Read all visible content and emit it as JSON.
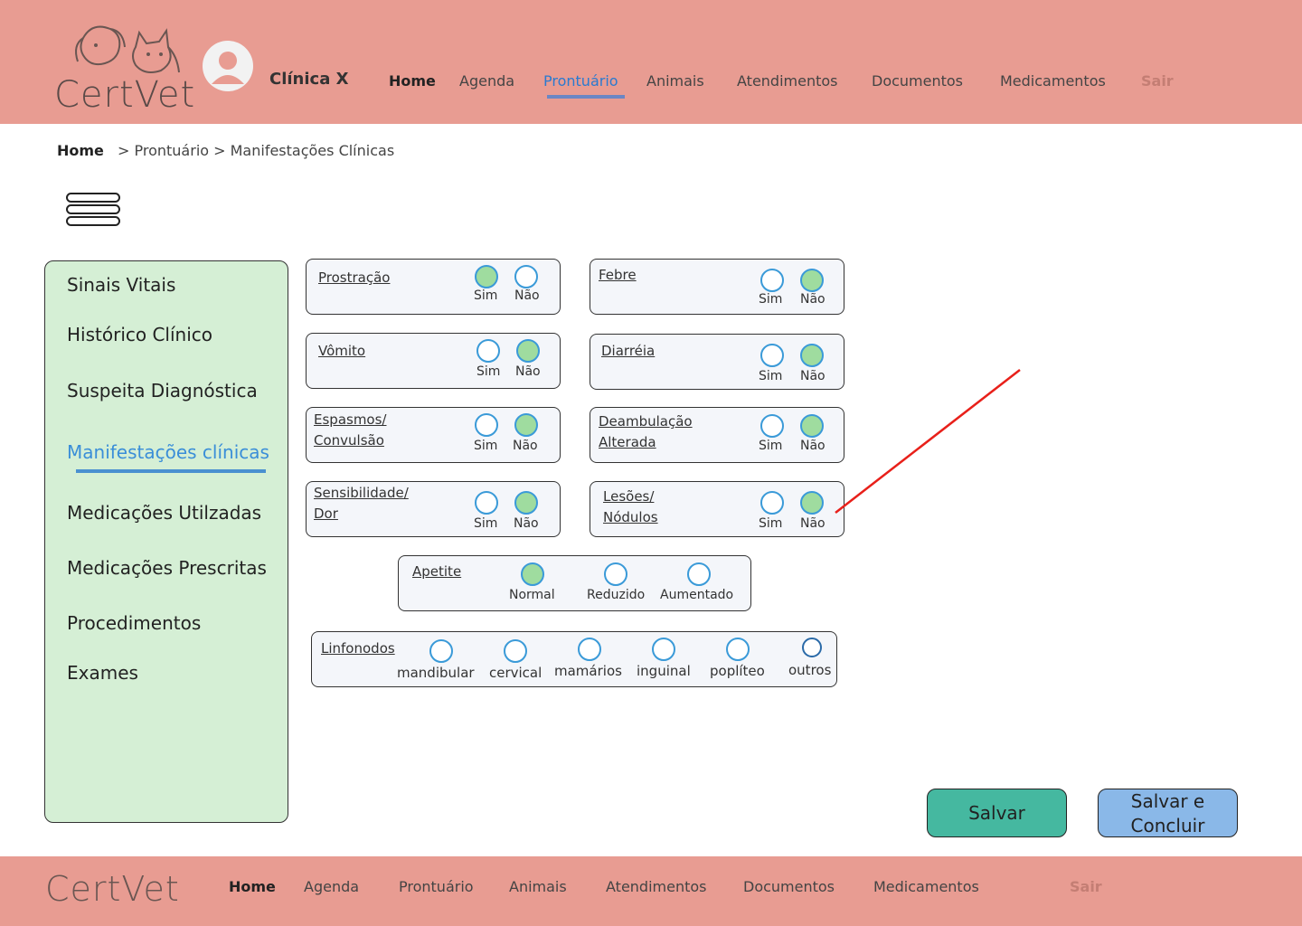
{
  "brand": {
    "name": "CertVet",
    "clinic": "Clínica X"
  },
  "nav": {
    "home": "Home",
    "agenda": "Agenda",
    "prontuario": "Prontuário",
    "animais": "Animais",
    "atendimentos": "Atendimentos",
    "documentos": "Documentos",
    "medicamentos": "Medicamentos",
    "sair": "Sair",
    "active": "Prontuário"
  },
  "breadcrumb": {
    "home": "Home",
    "path": "> Prontuário > Manifestações Clínicas"
  },
  "sidebar": {
    "items": [
      {
        "label": "Sinais Vitais"
      },
      {
        "label": "Histórico Clínico"
      },
      {
        "label": "Suspeita Diagnóstica"
      },
      {
        "label": "Manifestações clínicas",
        "active": true
      },
      {
        "label": "Medicações Utilzadas"
      },
      {
        "label": "Medicações Prescritas"
      },
      {
        "label": "Procedimentos"
      },
      {
        "label": "Exames"
      }
    ]
  },
  "options": {
    "sim": "Sim",
    "nao": "Não"
  },
  "manifestations": {
    "prostracao": {
      "line1": "Prostração",
      "selected": "Sim"
    },
    "febre": {
      "line1": "Febre",
      "selected": "Não"
    },
    "vomito": {
      "line1": "Vômito",
      "selected": "Não"
    },
    "diarreia": {
      "line1": "Diarréia",
      "selected": "Não"
    },
    "espasmos": {
      "line1": "Espasmos/",
      "line2": "Convulsão",
      "selected": "Não"
    },
    "deambulacao": {
      "line1": "Deambulação",
      "line2": "Alterada",
      "selected": "Não"
    },
    "sensibilidade": {
      "line1": "Sensibilidade/",
      "line2": "Dor",
      "selected": "Não"
    },
    "lesoes": {
      "line1": "Lesões/",
      "line2": "Nódulos",
      "selected": "Não"
    }
  },
  "apetite": {
    "label": "Apetite",
    "options": [
      "Normal",
      "Reduzido",
      "Aumentado"
    ],
    "selected": "Normal"
  },
  "linfonodos": {
    "label": "Linfonodos",
    "options": [
      "mandibular",
      "cervical",
      "mamários",
      "inguinal",
      "poplíteo",
      "outros"
    ]
  },
  "buttons": {
    "save": "Salvar",
    "save_finish_line1": "Salvar e",
    "save_finish_line2": "Concluir"
  },
  "colors": {
    "header": "#e89c92",
    "sidebar": "#d5efd5",
    "radio_selected": "#9fdc9f",
    "accent": "#2a7ad0",
    "save": "#45b8a0",
    "finish": "#8ab8e8"
  }
}
